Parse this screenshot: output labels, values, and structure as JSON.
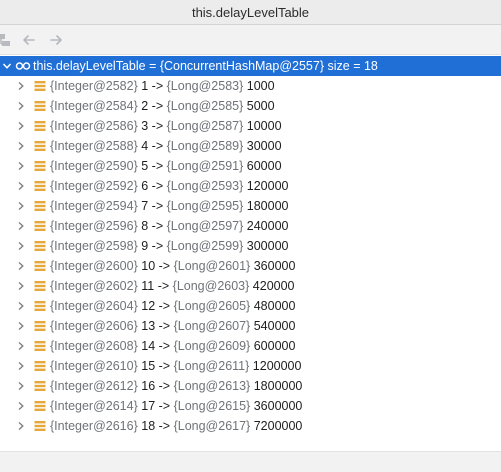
{
  "window": {
    "title": "this.delayLevelTable"
  },
  "toolbar": {
    "icons": [
      "hierarchy-icon",
      "back-arrow-icon",
      "forward-arrow-icon"
    ]
  },
  "root": {
    "label": "this.delayLevelTable",
    "equals": " = ",
    "ref": "{ConcurrentHashMap@2557}",
    "size_text": "  size = 18"
  },
  "entries": [
    {
      "key_ref": "{Integer@2582}",
      "key": "1",
      "arrow": " -> ",
      "value_ref": "{Long@2583}",
      "value": "1000"
    },
    {
      "key_ref": "{Integer@2584}",
      "key": "2",
      "arrow": " -> ",
      "value_ref": "{Long@2585}",
      "value": "5000"
    },
    {
      "key_ref": "{Integer@2586}",
      "key": "3",
      "arrow": " -> ",
      "value_ref": "{Long@2587}",
      "value": "10000"
    },
    {
      "key_ref": "{Integer@2588}",
      "key": "4",
      "arrow": " -> ",
      "value_ref": "{Long@2589}",
      "value": "30000"
    },
    {
      "key_ref": "{Integer@2590}",
      "key": "5",
      "arrow": " -> ",
      "value_ref": "{Long@2591}",
      "value": "60000"
    },
    {
      "key_ref": "{Integer@2592}",
      "key": "6",
      "arrow": " -> ",
      "value_ref": "{Long@2593}",
      "value": "120000"
    },
    {
      "key_ref": "{Integer@2594}",
      "key": "7",
      "arrow": " -> ",
      "value_ref": "{Long@2595}",
      "value": "180000"
    },
    {
      "key_ref": "{Integer@2596}",
      "key": "8",
      "arrow": " -> ",
      "value_ref": "{Long@2597}",
      "value": "240000"
    },
    {
      "key_ref": "{Integer@2598}",
      "key": "9",
      "arrow": " -> ",
      "value_ref": "{Long@2599}",
      "value": "300000"
    },
    {
      "key_ref": "{Integer@2600}",
      "key": "10",
      "arrow": " -> ",
      "value_ref": "{Long@2601}",
      "value": "360000"
    },
    {
      "key_ref": "{Integer@2602}",
      "key": "11",
      "arrow": " -> ",
      "value_ref": "{Long@2603}",
      "value": "420000"
    },
    {
      "key_ref": "{Integer@2604}",
      "key": "12",
      "arrow": " -> ",
      "value_ref": "{Long@2605}",
      "value": "480000"
    },
    {
      "key_ref": "{Integer@2606}",
      "key": "13",
      "arrow": " -> ",
      "value_ref": "{Long@2607}",
      "value": "540000"
    },
    {
      "key_ref": "{Integer@2608}",
      "key": "14",
      "arrow": " -> ",
      "value_ref": "{Long@2609}",
      "value": "600000"
    },
    {
      "key_ref": "{Integer@2610}",
      "key": "15",
      "arrow": " -> ",
      "value_ref": "{Long@2611}",
      "value": "1200000"
    },
    {
      "key_ref": "{Integer@2612}",
      "key": "16",
      "arrow": " -> ",
      "value_ref": "{Long@2613}",
      "value": "1800000"
    },
    {
      "key_ref": "{Integer@2614}",
      "key": "17",
      "arrow": " -> ",
      "value_ref": "{Long@2615}",
      "value": "3600000"
    },
    {
      "key_ref": "{Integer@2616}",
      "key": "18",
      "arrow": " -> ",
      "value_ref": "{Long@2617}",
      "value": "7200000"
    }
  ],
  "colors": {
    "selection": "#1f6fd6",
    "field_icon": "#e6a83a",
    "ref_text": "#6f7377"
  }
}
